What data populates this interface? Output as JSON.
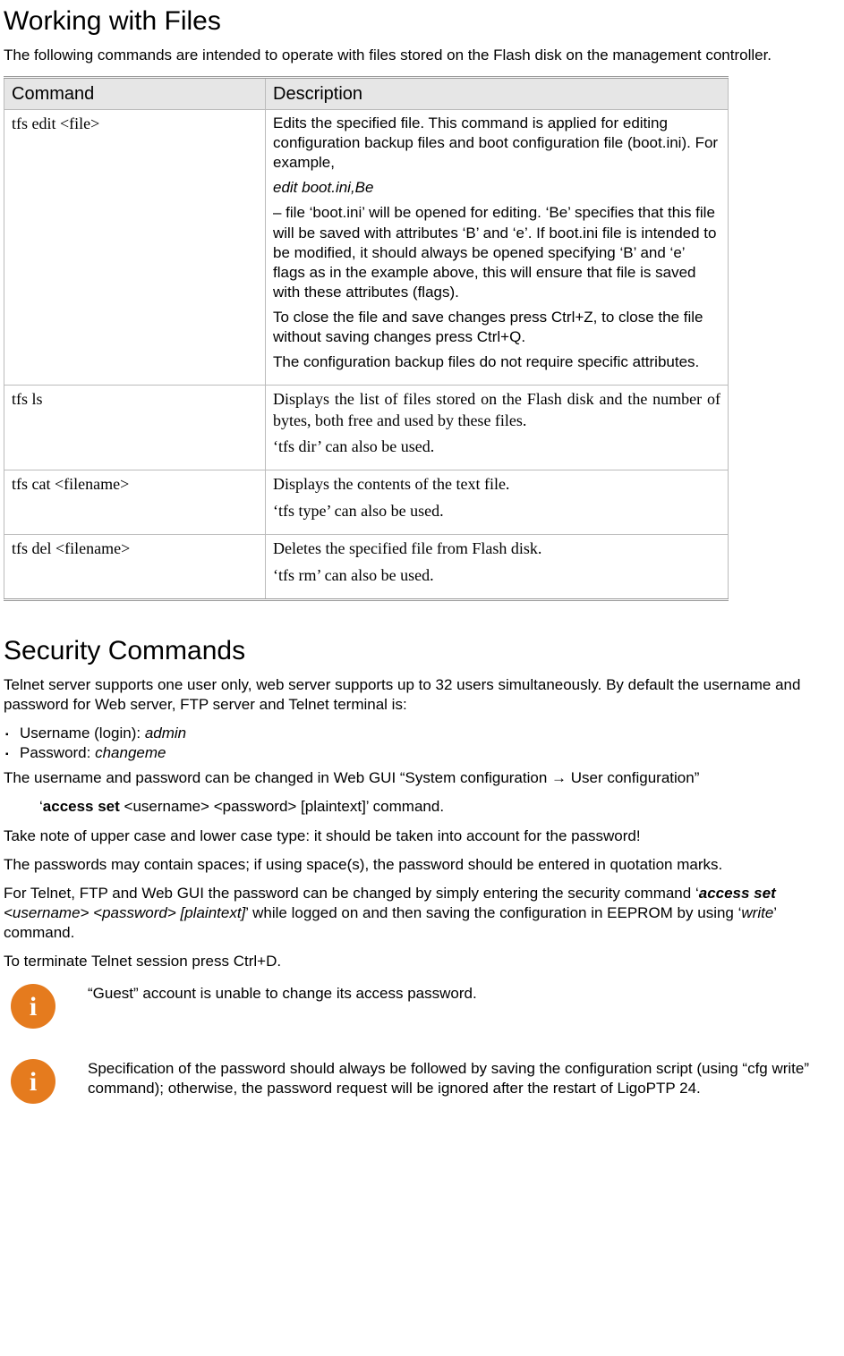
{
  "section1": {
    "title": "Working with Files",
    "intro": "The following commands are intended to operate with files stored on the Flash disk on the management controller.",
    "th_command": "Command",
    "th_description": "Description",
    "rows": {
      "r0": {
        "cmd": "tfs edit <file>",
        "p1": "Edits the specified file. This command is applied for editing configuration backup files and boot configuration file (boot.ini). For example,",
        "example": " edit boot.ini,Be",
        "p2": "– file ‘boot.ini’ will be opened for editing. ‘Be’ specifies that this file will be saved with attributes ‘B’ and ‘e’. If boot.ini file is intended to be modified, it should always be opened specifying ‘B’ and ‘e’ flags as in the example above, this will ensure that file is saved with these attributes (flags).",
        "p3": "To close the file and save changes press Ctrl+Z, to close the file without saving changes press Ctrl+Q.",
        "p4": "The configuration backup files do not require specific attributes."
      },
      "r1": {
        "cmd": "tfs ls",
        "p1": "Displays the list of files stored on the Flash disk and the number of bytes, both free and used by these files.",
        "p2": "‘tfs dir’ can also be used."
      },
      "r2": {
        "cmd": "tfs cat <filename>",
        "p1": "Displays the contents of the text file.",
        "p2": "‘tfs type’ can also be used."
      },
      "r3": {
        "cmd": "tfs del <filename>",
        "p1": "Deletes the specified file from Flash disk.",
        "p2": "‘tfs rm’ can also be used."
      }
    }
  },
  "section2": {
    "title": "Security Commands",
    "intro": "Telnet server supports one user only, web server supports up to 32 users simultaneously. By default the username and password for Web server, FTP server and Telnet terminal is:",
    "creds": {
      "user_label": "Username (login): ",
      "user_val": "admin",
      "pass_label": "Password: ",
      "pass_val": "changeme"
    },
    "p2": "The username and password can be changed in Web GUI “System configuration → User configuration”",
    "cmd_line": {
      "q1": "‘",
      "bold": "access set",
      "rest": " <username> <password> [plaintext]’ command."
    },
    "p3": "Take note of upper case and lower case type: it should be taken into account for the password!",
    "p4": "The passwords may contain spaces; if using space(s), the password should be entered in quotation marks.",
    "p5a": "For Telnet, FTP and Web GUI the password can be changed by simply entering the security command ‘",
    "p5b_bi": "access set",
    "p5c_i": " <username> <password> [plaintext]",
    "p5d": "’ while logged on and then saving the configuration in EEPROM by using ‘",
    "p5e_i": "write",
    "p5f": "’ command.",
    "p6": "To terminate Telnet session press Ctrl+D.",
    "info1": "“Guest” account is unable to change its access password.",
    "info2": "Specification of the password should always be followed by saving the configuration script (using “cfg write” command); otherwise, the password request will be ignored after the restart of LigoPTP 24.",
    "info_icon_char": "i"
  }
}
